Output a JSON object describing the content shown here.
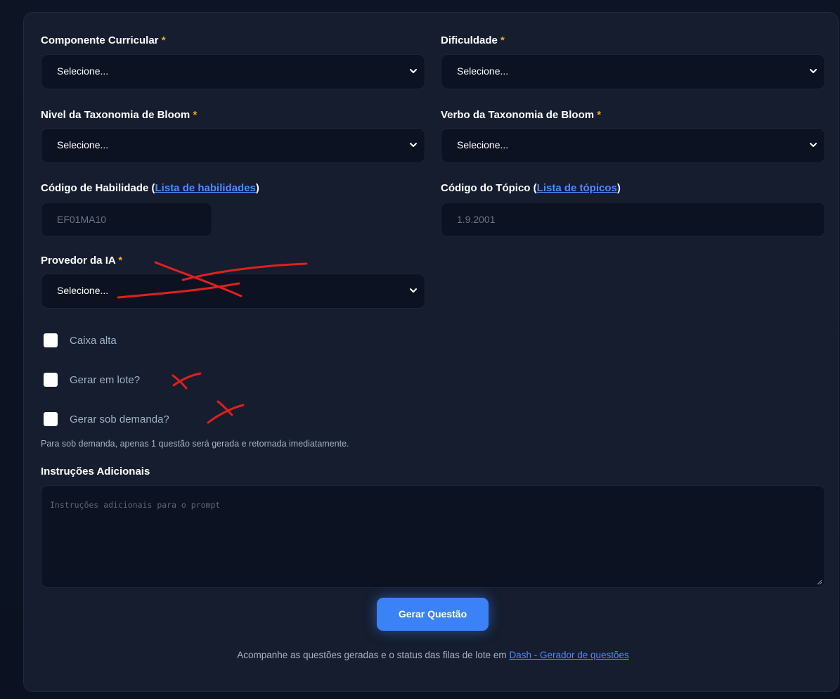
{
  "form": {
    "componente": {
      "label": "Componente Curricular",
      "required": "*",
      "value": "Selecione..."
    },
    "dificuldade": {
      "label": "Dificuldade",
      "required": "*",
      "value": "Selecione..."
    },
    "nivel_bloom": {
      "label": "Nivel da Taxonomia de Bloom",
      "required": "*",
      "value": "Selecione..."
    },
    "verbo_bloom": {
      "label": "Verbo da Taxonomia de Bloom",
      "required": "*",
      "value": "Selecione..."
    },
    "codigo_habilidade": {
      "label": "Código de Habilidade",
      "link_open": "(",
      "link_text": "Lista de habilidades",
      "link_close": ")",
      "value": "EF01MA10"
    },
    "codigo_topico": {
      "label": "Código do Tópico",
      "link_open": "(",
      "link_text": "Lista de tópicos",
      "link_close": ")",
      "value": "1.9.2001"
    },
    "provedor_ia": {
      "label": "Provedor da IA",
      "required": "*",
      "value": "Selecione..."
    },
    "checkboxes": [
      {
        "label": "Caixa alta",
        "checked": false
      },
      {
        "label": "Gerar em lote?",
        "checked": false
      },
      {
        "label": "Gerar sob demanda?",
        "checked": false
      }
    ],
    "help_text": "Para sob demanda, apenas 1 questão será gerada e retornada imediatamente.",
    "instrucoes": {
      "label": "Instruções Adicionais",
      "placeholder": "Instruções adicionais para o prompt"
    },
    "submit_label": "Gerar Questão"
  },
  "footer": {
    "text": "Acompanhe as questões geradas e o status das filas de lote em",
    "link_text": "Dash - Gerador de questões"
  },
  "colors": {
    "background": "#0b1120",
    "card": "#151d2e",
    "field": "#0c1221",
    "accent": "#3b82f6",
    "link": "#4f8cff",
    "required": "#f5a524",
    "annotation": "#e0201c"
  }
}
